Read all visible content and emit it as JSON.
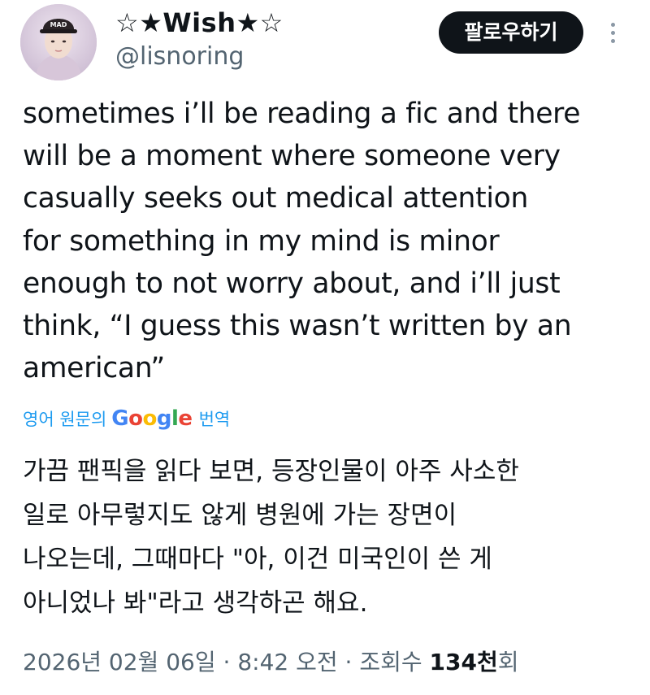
{
  "profile": {
    "display_name": "☆★Wish★☆",
    "handle": "@lisnoring",
    "follow_label": "팔로우하기",
    "avatar_cap_text": "MAD"
  },
  "tweet": {
    "lines": [
      "sometimes i’ll be reading a fic and there",
      "will be a moment where someone very",
      "casually seeks out medical attention",
      "for something in my mind is minor",
      "enough to not worry about, and i’ll just",
      "think, “I guess this wasn’t written by an",
      "american”"
    ]
  },
  "translation": {
    "prefix": "영어 원문의",
    "logo_letters": [
      "G",
      "o",
      "o",
      "g",
      "l",
      "e"
    ],
    "suffix": "번역",
    "lines": [
      "가끔 팬픽을 읽다 보면, 등장인물이 아주 사소한",
      "일로 아무렇지도 않게 병원에 가는 장면이",
      "나오는데, 그때마다 \"아, 이건 미국인이 쓴 게",
      "아니었나 봐\"라고 생각하곤 해요."
    ]
  },
  "meta": {
    "date": "2026년 02월 06일",
    "time": "8:42 오전",
    "views_label": "조회수",
    "views_count": "134천",
    "views_suffix": "회",
    "separator": "·"
  },
  "colors": {
    "text": "#0f1419",
    "secondary": "#536471",
    "link": "#1d9bf0",
    "button_bg": "#0f1419",
    "button_text": "#ffffff"
  },
  "icons": {
    "more": "more-vertical-icon"
  }
}
